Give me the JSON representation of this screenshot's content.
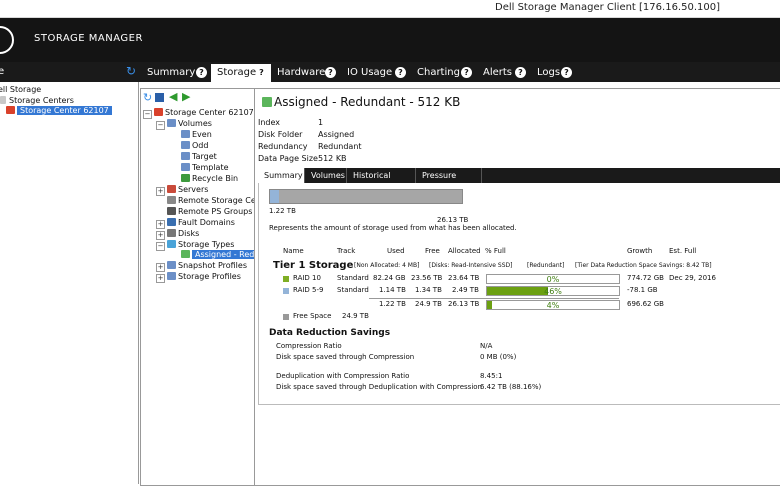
{
  "window": {
    "title": "Dell Storage Manager Client [176.16.50.100]"
  },
  "app": {
    "name": "STORAGE MANAGER"
  },
  "left_panel": {
    "header": "e",
    "tree": [
      {
        "label": "ell Storage"
      },
      {
        "label": "Storage Centers"
      },
      {
        "label": "Storage Center 62107",
        "selected": true
      }
    ]
  },
  "tabs": [
    {
      "label": "Summary"
    },
    {
      "label": "Storage",
      "active": true
    },
    {
      "label": "Hardware"
    },
    {
      "label": "IO Usage"
    },
    {
      "label": "Charting"
    },
    {
      "label": "Alerts"
    },
    {
      "label": "Logs"
    }
  ],
  "tab_help": "?",
  "mid_tree": [
    {
      "label": "Storage Center 62107"
    },
    {
      "label": "Volumes"
    },
    {
      "label": "Even"
    },
    {
      "label": "Odd"
    },
    {
      "label": "Target"
    },
    {
      "label": "Template"
    },
    {
      "label": "Recycle Bin"
    },
    {
      "label": "Servers"
    },
    {
      "label": "Remote Storage Cente"
    },
    {
      "label": "Remote PS Groups"
    },
    {
      "label": "Fault Domains"
    },
    {
      "label": "Disks"
    },
    {
      "label": "Storage Types"
    },
    {
      "label": "Assigned - Redun",
      "selected": true
    },
    {
      "label": "Snapshot Profiles"
    },
    {
      "label": "Storage Profiles"
    }
  ],
  "detail": {
    "title": "Assigned - Redundant - 512 KB",
    "properties": [
      {
        "key": "Index",
        "value": "1"
      },
      {
        "key": "Disk Folder",
        "value": "Assigned"
      },
      {
        "key": "Redundancy",
        "value": "Redundant"
      },
      {
        "key": "Data Page Size",
        "value": "512 KB"
      }
    ],
    "subtabs": [
      {
        "label": "Summary",
        "active": true
      },
      {
        "label": "Volumes"
      },
      {
        "label": "Historical Usage"
      },
      {
        "label": "Pressure Report"
      }
    ],
    "allocation": {
      "used_label": "1.22 TB",
      "total_label": "26.13 TB",
      "used_fraction": 0.047,
      "caption": "Represents the amount of storage used from what has been allocated."
    },
    "table": {
      "headers": [
        "Name",
        "Track",
        "Used",
        "Free",
        "Allocated",
        "% Full",
        "Growth",
        "Est. Full"
      ],
      "tier_title": "Tier 1 Storage",
      "tier_notes": [
        "[Non Allocated: 4 MB]",
        "[Disks: Read-Intensive SSD]",
        "[Redundant]",
        "[Tier Data Reduction Space Savings: 8.42 TB]"
      ],
      "rows": [
        {
          "name": "RAID 10",
          "color": "#7fae25",
          "track": "Standard",
          "used": "82.24 GB",
          "free": "23.56 TB",
          "allocated": "23.64 TB",
          "pct": "0%",
          "pct_value": 0.0,
          "growth": "774.72 GB",
          "est_full": "Dec 29, 2016"
        },
        {
          "name": "RAID 5-9",
          "color": "#94b4d8",
          "track": "Standard",
          "used": "1.14 TB",
          "free": "1.34 TB",
          "allocated": "2.49 TB",
          "pct": "46%",
          "pct_value": 0.46,
          "growth": "-78.1 GB",
          "est_full": ""
        }
      ],
      "total": {
        "used": "1.22 TB",
        "free": "24.9 TB",
        "allocated": "26.13 TB",
        "pct": "4%",
        "pct_value": 0.04,
        "growth": "696.62 GB"
      },
      "free_space": {
        "label": "Free Space",
        "value": "24.9 TB",
        "color": "#999999"
      }
    },
    "data_reduction": {
      "title": "Data Reduction Savings",
      "rows": [
        {
          "label": "Compression Ratio",
          "value": "N/A"
        },
        {
          "label": "Disk space saved through Compression",
          "value": "0 MB (0%)"
        },
        {
          "label": "Deduplication with Compression Ratio",
          "value": "8.45:1"
        },
        {
          "label": "Disk space saved through Deduplication with Compression",
          "value": "6.42 TB (88.16%)"
        }
      ]
    }
  }
}
